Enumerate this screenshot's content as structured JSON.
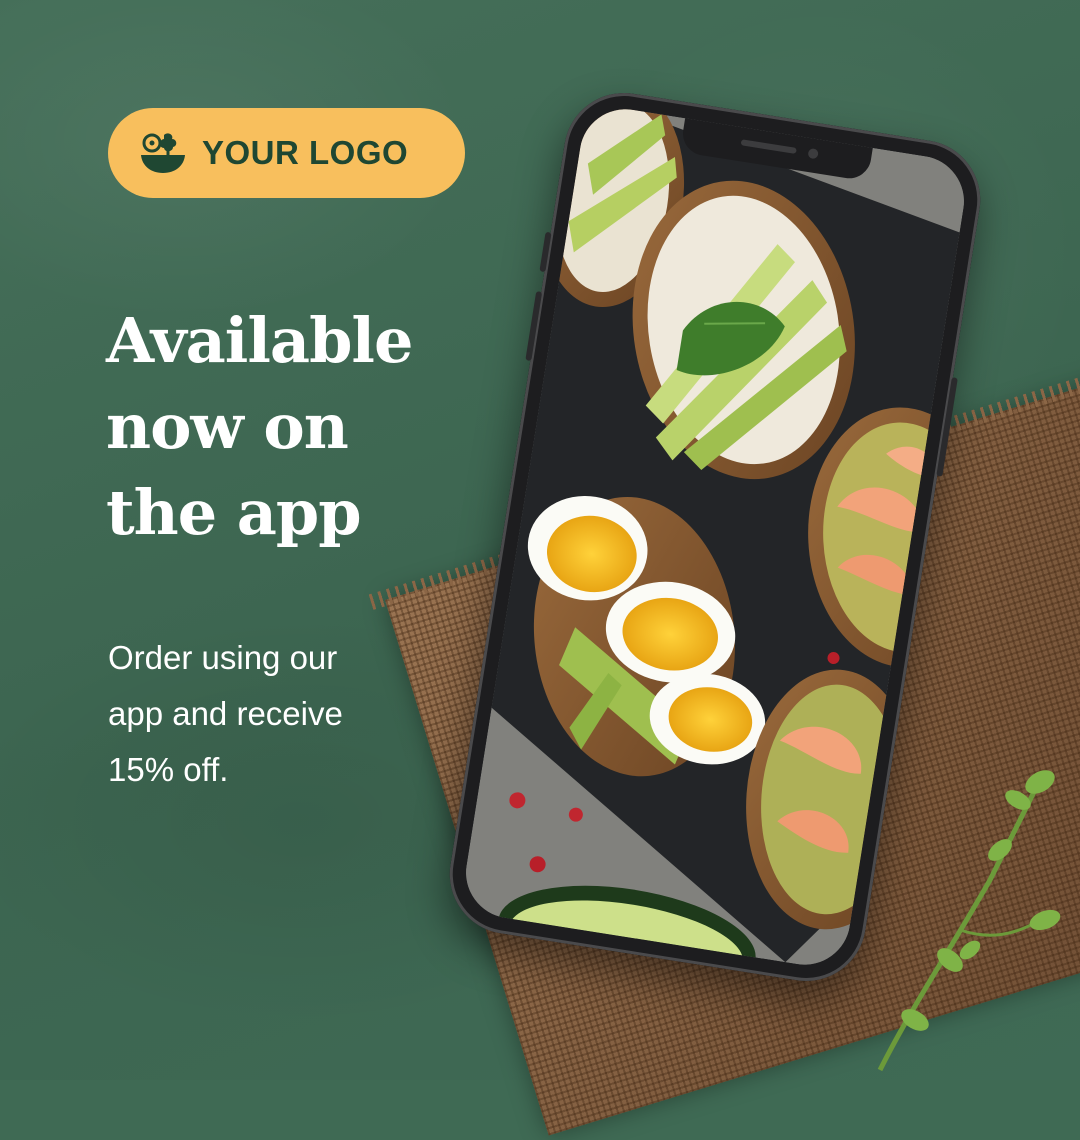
{
  "logo": {
    "text": "YOUR LOGO",
    "icon": "salad-bowl-icon",
    "background": "#f8bf5d",
    "text_color": "#1f4732"
  },
  "headline": {
    "lines": [
      "Available",
      "now on",
      "the app"
    ]
  },
  "subtext": {
    "lines": [
      "Order using our",
      "app and receive",
      "15% off."
    ]
  },
  "phone": {
    "screen_image": "food-photo-avocado-toasts"
  },
  "colors": {
    "background": "#3f6a54",
    "accent": "#f8bf5d",
    "text": "#ffffff"
  }
}
